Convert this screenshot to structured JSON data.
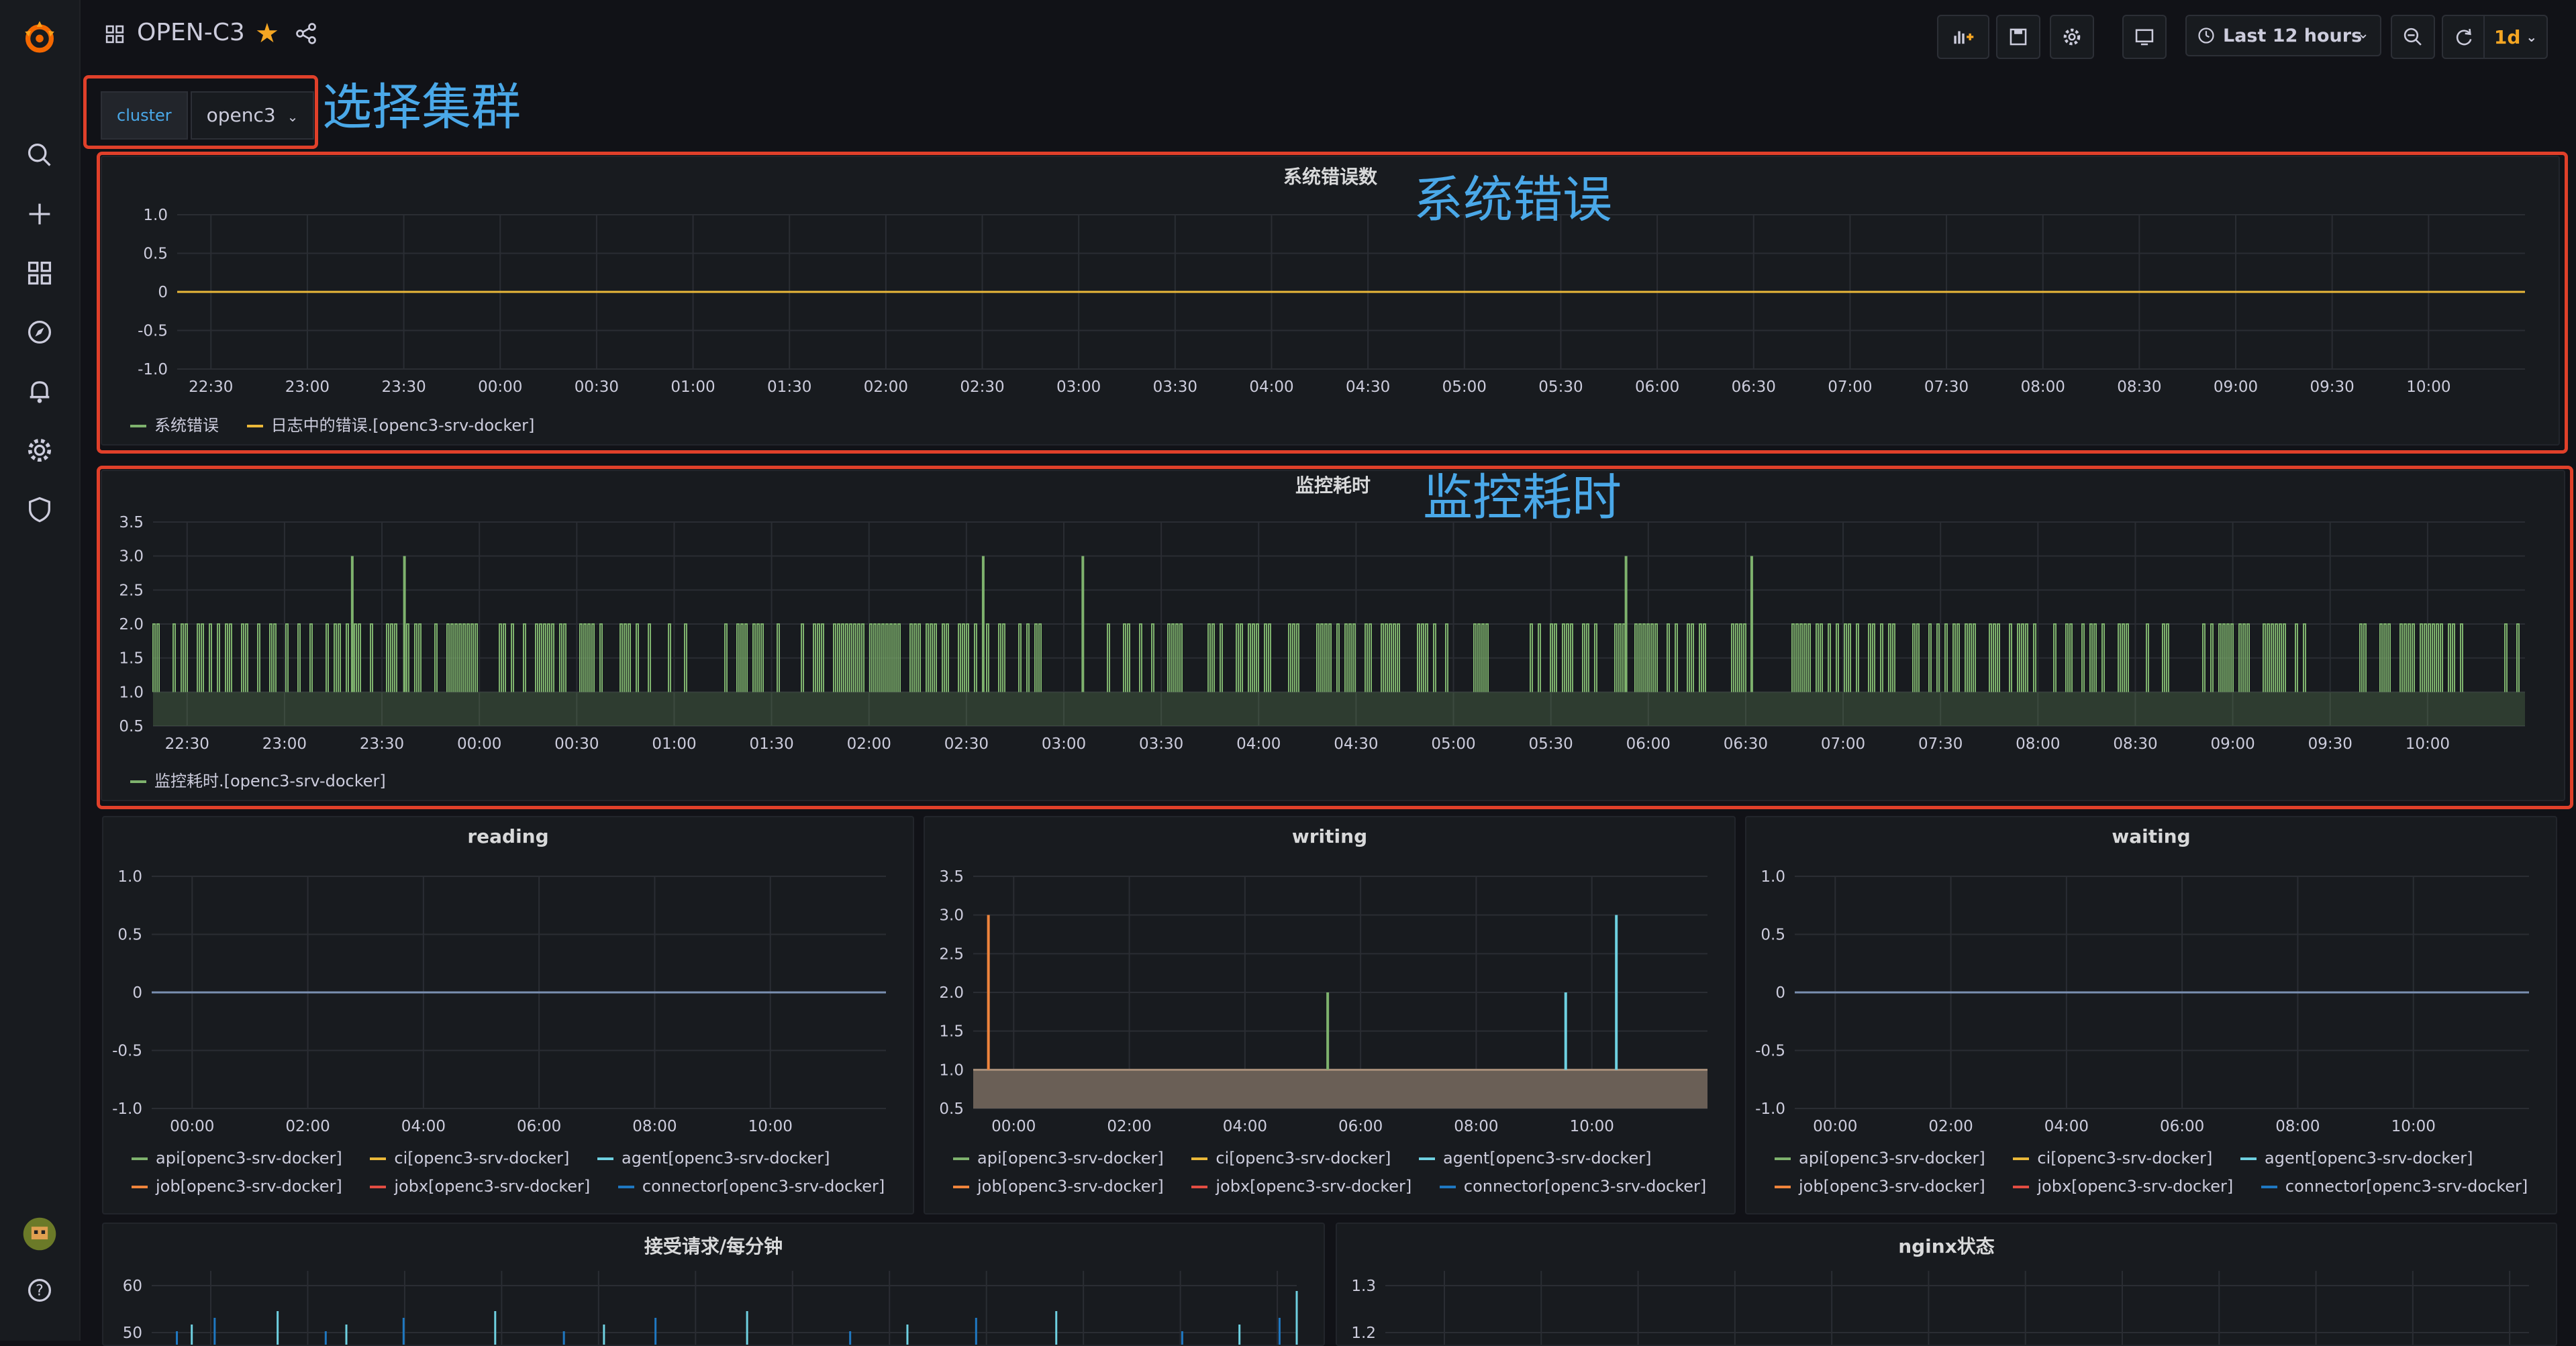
{
  "topbar": {
    "title": "OPEN-C3",
    "time_range": "Last 12 hours",
    "refresh_interval": "1d"
  },
  "variable": {
    "label": "cluster",
    "value": "openc3"
  },
  "annotations": {
    "select_cluster": "选择集群",
    "system_errors": "系统错误",
    "monitor_time": "监控耗时"
  },
  "icons": {
    "sidebar": [
      "grafana-logo-icon",
      "search-icon",
      "plus-icon",
      "dashboards-icon",
      "explore-icon",
      "alerting-icon",
      "gear-icon",
      "shield-icon",
      "user-avatar",
      "help-icon"
    ],
    "topbar": [
      "add-panel-icon",
      "save-icon",
      "settings-icon",
      "tv-mode-icon",
      "clock-icon",
      "zoom-out-icon",
      "refresh-icon"
    ]
  },
  "colors": {
    "background": "#111217",
    "panel": "#181b1f",
    "annotation_red": "#e0402a",
    "annotation_blue": "#4aa8e8",
    "star": "#f5a623",
    "series_green": "#7eb26d",
    "series_yellow": "#eab839",
    "series_blue": "#6ed0e0",
    "series_orange": "#ef843c"
  },
  "chart_data": [
    {
      "type": "line",
      "title": "系统错误数",
      "x_ticks": [
        "22:30",
        "23:00",
        "23:30",
        "00:00",
        "00:30",
        "01:00",
        "01:30",
        "02:00",
        "02:30",
        "03:00",
        "03:30",
        "04:00",
        "04:30",
        "05:00",
        "05:30",
        "06:00",
        "06:30",
        "07:00",
        "07:30",
        "08:00",
        "08:30",
        "09:00",
        "09:30",
        "10:00"
      ],
      "y_ticks": [
        "1.0",
        "0.5",
        "0",
        "-0.5",
        "-1.0"
      ],
      "ylim": [
        -1,
        1
      ],
      "series": [
        {
          "name": "系统错误",
          "color": "#7eb26d",
          "values": [
            0
          ]
        },
        {
          "name": "日志中的错误.[openc3-srv-docker]",
          "color": "#eab839",
          "values": [
            0
          ]
        }
      ]
    },
    {
      "type": "area",
      "title": "监控耗时",
      "x_ticks": [
        "22:30",
        "23:00",
        "23:30",
        "00:00",
        "00:30",
        "01:00",
        "01:30",
        "02:00",
        "02:30",
        "03:00",
        "03:30",
        "04:00",
        "04:30",
        "05:00",
        "05:30",
        "06:00",
        "06:30",
        "07:00",
        "07:30",
        "08:00",
        "08:30",
        "09:00",
        "09:30",
        "10:00"
      ],
      "y_ticks": [
        "3.5",
        "3.0",
        "2.5",
        "2.0",
        "1.5",
        "1.0",
        "0.5"
      ],
      "ylim": [
        0.5,
        3.5
      ],
      "baseline_value": 1,
      "typical_value": 2,
      "spikes_value": 3,
      "series": [
        {
          "name": "监控耗时.[openc3-srv-docker]",
          "color": "#7eb26d"
        }
      ]
    },
    {
      "type": "line",
      "title": "reading",
      "x_ticks": [
        "00:00",
        "02:00",
        "04:00",
        "06:00",
        "08:00",
        "10:00"
      ],
      "y_ticks": [
        "1.0",
        "0.5",
        "0",
        "-0.5",
        "-1.0"
      ],
      "ylim": [
        -1,
        1
      ],
      "series": [
        {
          "name": "api[openc3-srv-docker]",
          "color": "#7eb26d",
          "values": [
            0
          ]
        },
        {
          "name": "ci[openc3-srv-docker]",
          "color": "#eab839",
          "values": [
            0
          ]
        },
        {
          "name": "agent[openc3-srv-docker]",
          "color": "#6ed0e0",
          "values": [
            0
          ]
        },
        {
          "name": "job[openc3-srv-docker]",
          "color": "#ef843c",
          "values": [
            0
          ]
        },
        {
          "name": "jobx[openc3-srv-docker]",
          "color": "#e24d42",
          "values": [
            0
          ]
        },
        {
          "name": "connector[openc3-srv-docker]",
          "color": "#1f78c1",
          "values": [
            0
          ]
        }
      ]
    },
    {
      "type": "area",
      "title": "writing",
      "x_ticks": [
        "00:00",
        "02:00",
        "04:00",
        "06:00",
        "08:00",
        "10:00"
      ],
      "y_ticks": [
        "3.5",
        "3.0",
        "2.5",
        "2.0",
        "1.5",
        "1.0",
        "0.5"
      ],
      "ylim": [
        0.5,
        3.5
      ],
      "baseline_value": 1,
      "series": [
        {
          "name": "api[openc3-srv-docker]",
          "color": "#7eb26d"
        },
        {
          "name": "ci[openc3-srv-docker]",
          "color": "#eab839"
        },
        {
          "name": "agent[openc3-srv-docker]",
          "color": "#6ed0e0"
        },
        {
          "name": "job[openc3-srv-docker]",
          "color": "#ef843c"
        },
        {
          "name": "jobx[openc3-srv-docker]",
          "color": "#e24d42"
        },
        {
          "name": "connector[openc3-srv-docker]",
          "color": "#1f78c1"
        }
      ],
      "spikes": [
        {
          "x": "22:50",
          "value": 3,
          "color": "#ef843c"
        },
        {
          "x": "04:25",
          "value": 2,
          "color": "#7eb26d"
        },
        {
          "x": "08:20",
          "value": 2,
          "color": "#6ed0e0"
        },
        {
          "x": "09:10",
          "value": 3,
          "color": "#6ed0e0"
        }
      ]
    },
    {
      "type": "line",
      "title": "waiting",
      "x_ticks": [
        "00:00",
        "02:00",
        "04:00",
        "06:00",
        "08:00",
        "10:00"
      ],
      "y_ticks": [
        "1.0",
        "0.5",
        "0",
        "-0.5",
        "-1.0"
      ],
      "ylim": [
        -1,
        1
      ],
      "series": [
        {
          "name": "api[openc3-srv-docker]",
          "color": "#7eb26d",
          "values": [
            0
          ]
        },
        {
          "name": "ci[openc3-srv-docker]",
          "color": "#eab839",
          "values": [
            0
          ]
        },
        {
          "name": "agent[openc3-srv-docker]",
          "color": "#6ed0e0",
          "values": [
            0
          ]
        },
        {
          "name": "job[openc3-srv-docker]",
          "color": "#ef843c",
          "values": [
            0
          ]
        },
        {
          "name": "jobx[openc3-srv-docker]",
          "color": "#e24d42",
          "values": [
            0
          ]
        },
        {
          "name": "connector[openc3-srv-docker]",
          "color": "#1f78c1",
          "values": [
            0
          ]
        }
      ]
    },
    {
      "type": "line",
      "title": "接受请求/每分钟",
      "y_ticks": [
        "60",
        "50"
      ]
    },
    {
      "type": "line",
      "title": "nginx状态",
      "y_ticks": [
        "1.3",
        "1.2"
      ]
    }
  ]
}
